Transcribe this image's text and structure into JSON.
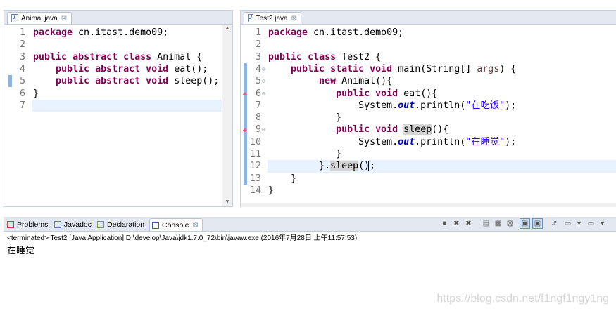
{
  "left_editor": {
    "tab_label": "Animal.java",
    "close_glyph": "⊠",
    "lines": [
      {
        "n": "1",
        "tokens": [
          {
            "t": "package",
            "c": "kw"
          },
          {
            "t": " cn.itast.demo09;",
            "c": ""
          }
        ]
      },
      {
        "n": "2",
        "tokens": []
      },
      {
        "n": "3",
        "tokens": [
          {
            "t": "public",
            "c": "kw"
          },
          {
            "t": " ",
            "c": ""
          },
          {
            "t": "abstract",
            "c": "kw"
          },
          {
            "t": " ",
            "c": ""
          },
          {
            "t": "class",
            "c": "kw"
          },
          {
            "t": " Animal {",
            "c": ""
          }
        ]
      },
      {
        "n": "4",
        "tokens": [
          {
            "t": "    ",
            "c": ""
          },
          {
            "t": "public",
            "c": "kw"
          },
          {
            "t": " ",
            "c": ""
          },
          {
            "t": "abstract",
            "c": "kw"
          },
          {
            "t": " ",
            "c": ""
          },
          {
            "t": "void",
            "c": "kw"
          },
          {
            "t": " eat();",
            "c": ""
          }
        ]
      },
      {
        "n": "5",
        "tokens": [
          {
            "t": "    ",
            "c": ""
          },
          {
            "t": "public",
            "c": "kw"
          },
          {
            "t": " ",
            "c": ""
          },
          {
            "t": "abstract",
            "c": "kw"
          },
          {
            "t": " ",
            "c": ""
          },
          {
            "t": "void",
            "c": "kw"
          },
          {
            "t": " sleep();",
            "c": ""
          }
        ]
      },
      {
        "n": "6",
        "tokens": [
          {
            "t": "}",
            "c": ""
          }
        ]
      },
      {
        "n": "7",
        "tokens": []
      }
    ]
  },
  "right_editor": {
    "tab_label": "Test2.java",
    "close_glyph": "⊠",
    "lines": [
      {
        "n": "1",
        "tokens": [
          {
            "t": "package",
            "c": "kw"
          },
          {
            "t": " cn.itast.demo09;",
            "c": ""
          }
        ]
      },
      {
        "n": "2",
        "tokens": []
      },
      {
        "n": "3",
        "tokens": [
          {
            "t": "public",
            "c": "kw"
          },
          {
            "t": " ",
            "c": ""
          },
          {
            "t": "class",
            "c": "kw"
          },
          {
            "t": " Test2 {",
            "c": ""
          }
        ]
      },
      {
        "n": "4",
        "fold": "⊖",
        "tokens": [
          {
            "t": "    ",
            "c": ""
          },
          {
            "t": "public",
            "c": "kw"
          },
          {
            "t": " ",
            "c": ""
          },
          {
            "t": "static",
            "c": "kw"
          },
          {
            "t": " ",
            "c": ""
          },
          {
            "t": "void",
            "c": "kw"
          },
          {
            "t": " main(String[] ",
            "c": ""
          },
          {
            "t": "args",
            "c": "param"
          },
          {
            "t": ") {",
            "c": ""
          }
        ]
      },
      {
        "n": "5",
        "fold": "⊖",
        "tokens": [
          {
            "t": "         ",
            "c": ""
          },
          {
            "t": "new",
            "c": "kw"
          },
          {
            "t": " Animal(){",
            "c": ""
          }
        ]
      },
      {
        "n": "6",
        "fold": "⊖",
        "tokens": [
          {
            "t": "            ",
            "c": ""
          },
          {
            "t": "public",
            "c": "kw"
          },
          {
            "t": " ",
            "c": ""
          },
          {
            "t": "void",
            "c": "kw"
          },
          {
            "t": " eat(){",
            "c": ""
          }
        ]
      },
      {
        "n": "7",
        "tokens": [
          {
            "t": "                System.",
            "c": ""
          },
          {
            "t": "out",
            "c": "fld"
          },
          {
            "t": ".println(",
            "c": ""
          },
          {
            "t": "\"在吃饭\"",
            "c": "str"
          },
          {
            "t": ");",
            "c": ""
          }
        ]
      },
      {
        "n": "8",
        "tokens": [
          {
            "t": "            }",
            "c": ""
          }
        ]
      },
      {
        "n": "9",
        "fold": "⊖",
        "tokens": [
          {
            "t": "            ",
            "c": ""
          },
          {
            "t": "public",
            "c": "kw"
          },
          {
            "t": " ",
            "c": ""
          },
          {
            "t": "void",
            "c": "kw"
          },
          {
            "t": " ",
            "c": ""
          },
          {
            "t": "sleep",
            "c": "occ"
          },
          {
            "t": "(){",
            "c": ""
          }
        ]
      },
      {
        "n": "10",
        "tokens": [
          {
            "t": "                System.",
            "c": ""
          },
          {
            "t": "out",
            "c": "fld"
          },
          {
            "t": ".println(",
            "c": ""
          },
          {
            "t": "\"在睡觉\"",
            "c": "str"
          },
          {
            "t": ");",
            "c": ""
          }
        ]
      },
      {
        "n": "11",
        "tokens": [
          {
            "t": "            }",
            "c": ""
          }
        ]
      },
      {
        "n": "12",
        "tokens": [
          {
            "t": "         }.",
            "c": ""
          },
          {
            "t": "sleep",
            "c": "occ"
          },
          {
            "t": "();",
            "c": ""
          }
        ]
      },
      {
        "n": "13",
        "tokens": [
          {
            "t": "    }",
            "c": ""
          }
        ]
      },
      {
        "n": "14",
        "tokens": [
          {
            "t": "}",
            "c": ""
          }
        ]
      }
    ]
  },
  "console": {
    "tabs": [
      {
        "label": "Problems",
        "icon": "problems-icon"
      },
      {
        "label": "Javadoc",
        "icon": "javadoc-icon"
      },
      {
        "label": "Declaration",
        "icon": "declaration-icon"
      },
      {
        "label": "Console",
        "icon": "console-icon",
        "close": "⊠"
      }
    ],
    "status": "<terminated> Test2 [Java Application] D:\\develop\\Java\\jdk1.7.0_72\\bin\\javaw.exe (2016年7月28日 上午11:57:53)",
    "output": "在睡觉"
  },
  "watermark": "https://blog.csdn.net/f1ngf1ngy1ng",
  "colors": {
    "keyword": "#7f0055",
    "string": "#2a00ff",
    "field": "#0000c0",
    "line_highlight": "#e8f2fe"
  }
}
